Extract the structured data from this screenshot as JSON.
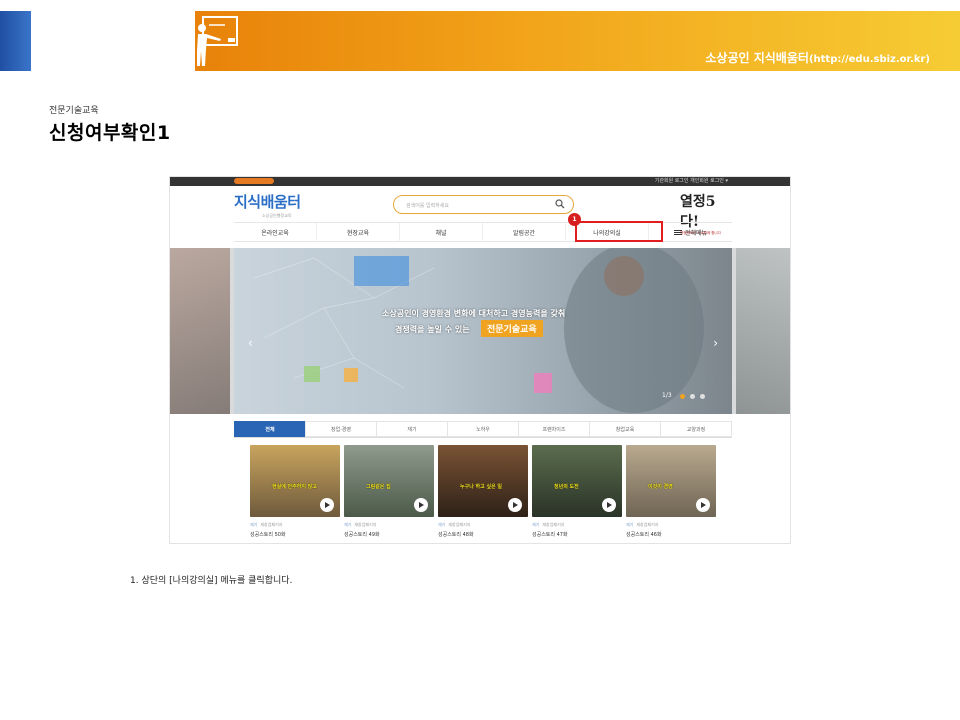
{
  "header": {
    "site_title": "소상공인 지식배움터",
    "site_url": "(http://edu.sbiz.or.kr)"
  },
  "slide": {
    "category": "전문기술교육",
    "title": "신청여부확인1",
    "instruction": "1. 상단의 [나의강의실] 메뉴를 클릭합니다."
  },
  "screenshot": {
    "top_links": "기관회원 로그인     개인회원 로그인 ▾",
    "logo_name": "지식배움터",
    "logo_sub": "소상공인행정교육",
    "search_placeholder": "검색어를 입력하세요",
    "slogan_big": "열정5다!",
    "slogan_small": "행정행복이 나와함께 합니다",
    "nav": [
      "온라인교육",
      "현장교육",
      "채널",
      "알림공간",
      "나의강의실",
      "전체메뉴"
    ],
    "callout_number": "1",
    "hero": {
      "line1": "소상공인이 경영환경 변화에 대처하고 경영능력을 갖춰",
      "line2_prefix": "경쟁력을 높일 수 있는",
      "line2_highlight": "전문기술교육",
      "pager": "1/3",
      "arrow_left": "‹",
      "arrow_right": "›"
    },
    "tabs": [
      "전체",
      "창업·경영",
      "재기",
      "노하우",
      "프랜차이즈",
      "창업교육",
      "교양과정"
    ],
    "cards": [
      {
        "meta_a": "재기",
        "meta_b": "재창업패키지",
        "title": "성공스토리 50화",
        "caption": "현실에 안주하지 않고"
      },
      {
        "meta_a": "재기",
        "meta_b": "재창업패키지",
        "title": "성공스토리 49화",
        "caption": "그림같은 집"
      },
      {
        "meta_a": "재기",
        "meta_b": "재창업패키지",
        "title": "성공스토리 48화",
        "caption": "누구나 하고 싶은 일"
      },
      {
        "meta_a": "재기",
        "meta_b": "재창업패키지",
        "title": "성공스토리 47화",
        "caption": "청년의 도전"
      },
      {
        "meta_a": "재기",
        "meta_b": "재창업패키지",
        "title": "성공스토리 46화",
        "caption": "이것이 경영"
      }
    ]
  },
  "colors": {
    "band_orange": "#e8820a",
    "band_yellow": "#f6cc34",
    "band_blue": "#1f4fa3",
    "highlight_red": "#e01e1e",
    "nav_active_blue": "#2a64b5",
    "hero_orange": "#f0a320"
  }
}
